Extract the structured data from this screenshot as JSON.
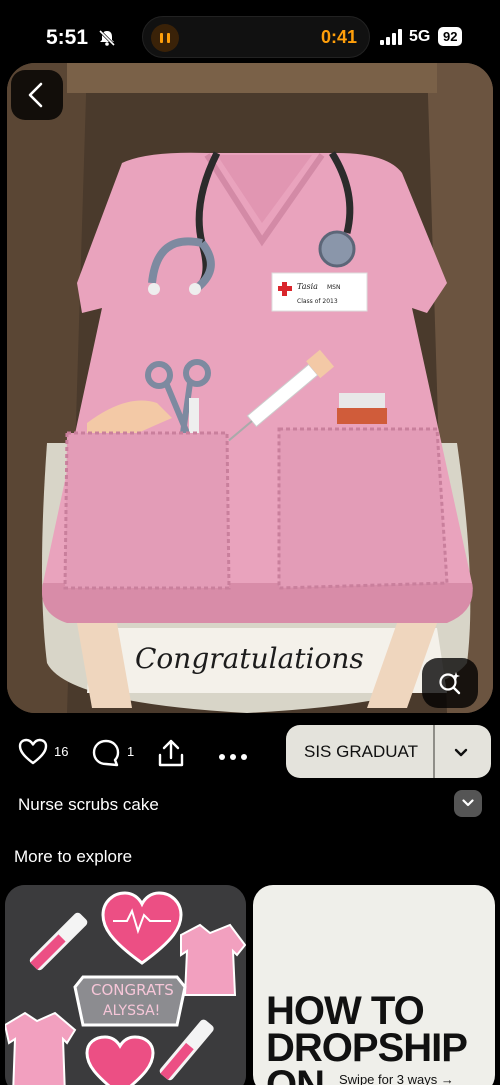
{
  "status_bar": {
    "time": "5:51",
    "recording_time": "0:41",
    "network": "5G",
    "battery": "92"
  },
  "pin": {
    "image_subject": "Pink nurse scrubs cake with stethoscope, scissors, syringe and name badge",
    "badge_name": "Tasia",
    "badge_suffix": "MSN",
    "badge_class": "Class of 2013",
    "cake_message": "Congratulations",
    "title": "Nurse scrubs cake"
  },
  "actions": {
    "like_count": "16",
    "comment_count": "1",
    "board_label": "SIS GRADUAT"
  },
  "more_to_explore": {
    "heading": "More to explore",
    "cookie_text_1": "CONGRATS",
    "cookie_text_2": "ALYSSA!",
    "ad_headline": "HOW TO DROPSHIP ON",
    "ad_sub": "Swipe for 3 ways →"
  },
  "colors": {
    "background": "#000000",
    "cake_pink": "#e9a3bd",
    "board_button": "#e4e3dc",
    "accent_orange": "#ff9f0a"
  }
}
